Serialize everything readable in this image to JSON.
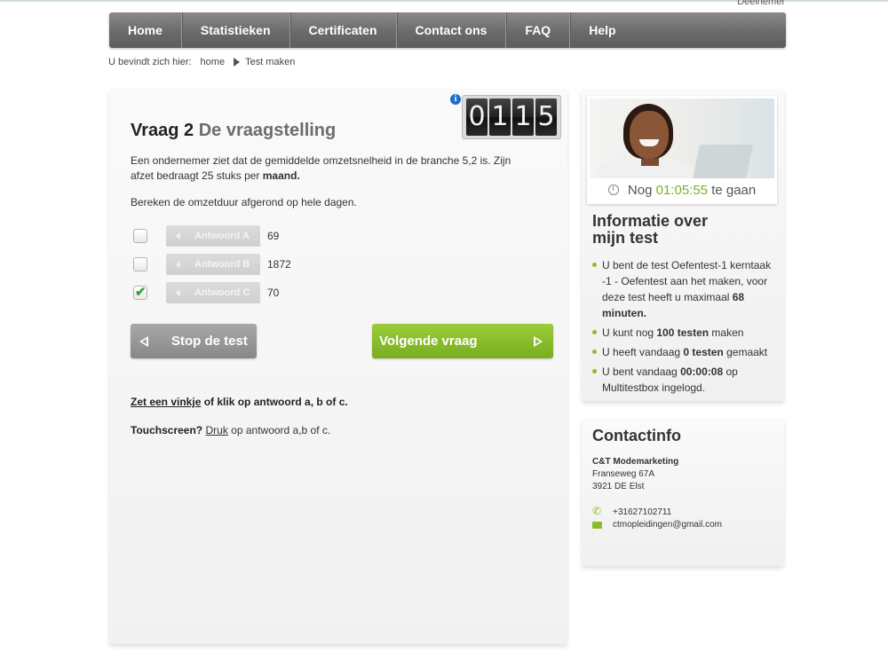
{
  "header": {
    "user_label": "Deelnemer"
  },
  "nav": {
    "items": [
      "Home",
      "Statistieken",
      "Certificaten",
      "Contact ons",
      "FAQ",
      "Help"
    ]
  },
  "breadcrumb": {
    "prefix": "U bevindt zich hier:",
    "home": "home",
    "current": "Test maken"
  },
  "counter": {
    "digits": [
      "0",
      "1",
      "1",
      "5"
    ],
    "info_icon": "info-icon"
  },
  "question": {
    "number": "Vraag 2",
    "title": "De vraagstelling",
    "text_part1": "Een ondernemer ziet dat de gemiddelde omzetsnelheid in de branche 5,2 is. Zijn afzet bedraagt 25 stuks per ",
    "text_bold": "maand.",
    "instruction": "Bereken de omzetduur afgerond op hele dagen."
  },
  "answers": [
    {
      "label": "Antwoord A",
      "value": "69",
      "checked": false
    },
    {
      "label": "Antwoord B",
      "value": "1872",
      "checked": false
    },
    {
      "label": "Antwoord C",
      "value": "70",
      "checked": true
    }
  ],
  "buttons": {
    "stop": "Stop de test",
    "next": "Volgende vraag"
  },
  "hints": {
    "line1_link": "Zet een vinkje",
    "line1_rest": " of klik op antwoord a, b of c.",
    "line2_bold": "Touchscreen?",
    "line2_link": "Druk",
    "line2_rest": " op antwoord a,b of c."
  },
  "timer": {
    "prefix": "Nog",
    "time": "01:05:55",
    "suffix": "te gaan"
  },
  "info": {
    "title_line1": "Informatie over",
    "title_line2": "mijn test",
    "items": [
      {
        "pre": "U bent de test Oefentest-1 kerntaak -1 - Oefentest aan het maken, voor deze test heeft u maximaal ",
        "bold": "68 minuten.",
        "post": ""
      },
      {
        "pre": "U kunt nog ",
        "bold": "100 testen",
        "post": " maken"
      },
      {
        "pre": "U heeft vandaag ",
        "bold": "0 testen",
        "post": " gemaakt"
      },
      {
        "pre": "U bent vandaag ",
        "bold": "00:00:08",
        "post": " op Multitestbox ingelogd."
      }
    ]
  },
  "contact": {
    "title": "Contactinfo",
    "company": "C&T Modemarketing",
    "street": "Franseweg 67A",
    "city": "3921 DE Elst",
    "phone": "+31627102711",
    "email": "ctmopleidingen@gmail.com"
  },
  "colors": {
    "accent_green": "#79b22a",
    "nav_gray": "#6a6a6a",
    "info_blue": "#1a6fd1"
  }
}
